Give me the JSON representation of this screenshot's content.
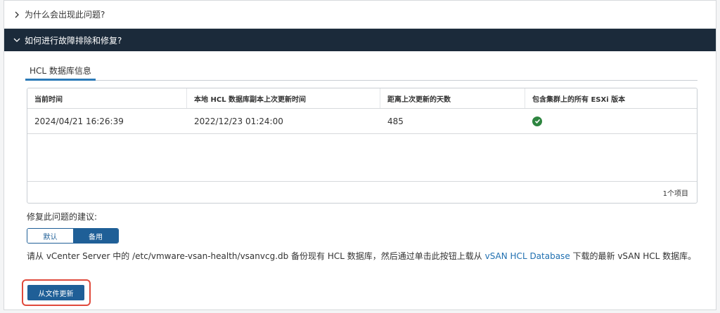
{
  "accordion": {
    "why": {
      "label": "为什么会出现此问题?"
    },
    "how": {
      "label": "如何进行故障排除和修复?"
    }
  },
  "tabs": [
    {
      "label": "HCL 数据库信息",
      "active": true
    }
  ],
  "table": {
    "columns": [
      "当前时间",
      "本地 HCL 数据库副本上次更新时间",
      "距离上次更新的天数",
      "包含集群上的所有 ESXi 版本"
    ],
    "rows": [
      [
        "2024/04/21 16:26:39",
        "2022/12/23 01:24:00",
        "485",
        "check-icon"
      ]
    ],
    "footer": "1个项目"
  },
  "suggestion": {
    "label": "修复此问题的建议:",
    "options": [
      {
        "label": "默认",
        "selected": false
      },
      {
        "label": "备用",
        "selected": true
      }
    ]
  },
  "description": {
    "part1": "请从 vCenter Server 中的 /etc/vmware-vsan-health/vsanvcg.db 备份现有 HCL 数据库，然后通过单击此按钮上载从 ",
    "link": "vSAN HCL Database",
    "part2": " 下载的最新 vSAN HCL 数据库。"
  },
  "button": {
    "label": "从文件更新"
  },
  "colors": {
    "header_dark": "#1b2a3a",
    "accent": "#1f5f97",
    "link": "#1f6fb0",
    "success": "#2e8540",
    "highlight": "#e04a3c"
  }
}
